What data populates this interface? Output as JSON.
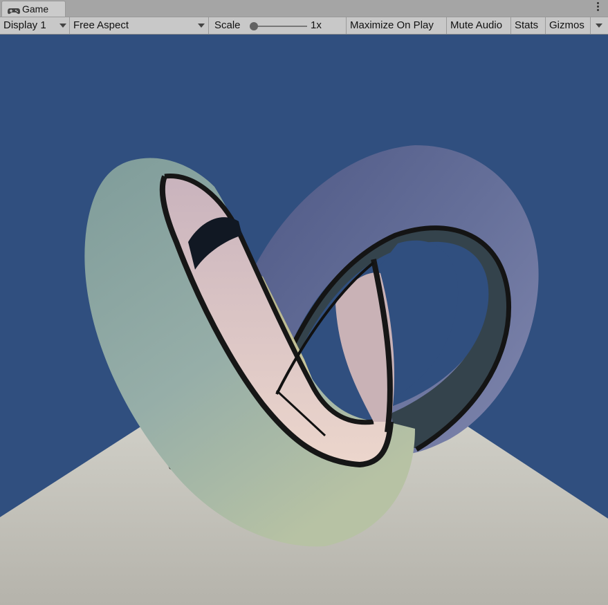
{
  "window": {
    "tab_label": "Game",
    "tab_icon": "gamepad-icon",
    "menu_icon": "kebab-menu-icon"
  },
  "toolbar": {
    "display_select": "Display 1",
    "aspect_select": "Free Aspect",
    "scale_label": "Scale",
    "scale_value": "1x",
    "scale_fraction": 0.0,
    "maximize_on_play": "Maximize On Play",
    "mute_audio": "Mute Audio",
    "stats": "Stats",
    "gizmos": "Gizmos"
  },
  "viewport": {
    "sky_color": "#304f7f",
    "floor_color": "#c9c8bf",
    "object": "trefoil-knot-torus"
  }
}
